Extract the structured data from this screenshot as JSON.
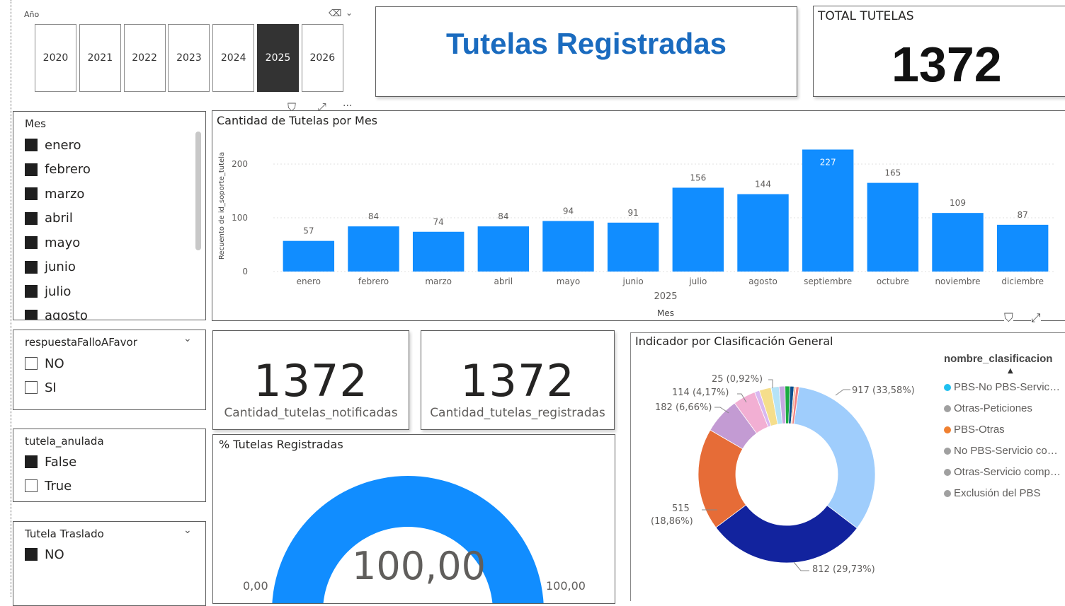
{
  "year_slicer": {
    "title": "Año",
    "years": [
      "2020",
      "2021",
      "2022",
      "2023",
      "2024",
      "2025",
      "2026"
    ],
    "selected": "2025"
  },
  "header": {
    "title": "Tutelas Registradas",
    "title_color": "#1a6bbf"
  },
  "total_card": {
    "label": "TOTAL TUTELAS",
    "value": "1372"
  },
  "mes_slicer": {
    "title": "Mes",
    "items": [
      {
        "label": "enero",
        "checked": true
      },
      {
        "label": "febrero",
        "checked": true
      },
      {
        "label": "marzo",
        "checked": true
      },
      {
        "label": "abril",
        "checked": true
      },
      {
        "label": "mayo",
        "checked": true
      },
      {
        "label": "junio",
        "checked": true
      },
      {
        "label": "julio",
        "checked": true
      },
      {
        "label": "agosto",
        "checked": true
      }
    ]
  },
  "bar_chart": {
    "title": "Cantidad de Tutelas por Mes",
    "bar_color": "#118dff"
  },
  "respuesta_slicer": {
    "title": "respuestaFalloAFavor",
    "items": [
      {
        "label": "NO",
        "checked": false
      },
      {
        "label": "SI",
        "checked": false
      }
    ]
  },
  "anulada_slicer": {
    "title": "tutela_anulada",
    "items": [
      {
        "label": "False",
        "checked": true
      },
      {
        "label": "True",
        "checked": false
      }
    ]
  },
  "traslado_slicer": {
    "title": "Tutela Traslado",
    "items": [
      {
        "label": "NO",
        "checked": true
      }
    ]
  },
  "kpi_notificadas": {
    "value": "1372",
    "label": "Cantidad_tutelas_notificadas"
  },
  "kpi_registradas": {
    "value": "1372",
    "label": "Cantidad_tutelas_registradas"
  },
  "gauge": {
    "title": "% Tutelas Registradas",
    "value_label": "100,00",
    "min_label": "0,00",
    "max_label": "100,00",
    "fill_fraction": 1.0,
    "color": "#118dff"
  },
  "donut": {
    "title": "Indicador por Clasificación General",
    "legend_title": "nombre_clasificacion",
    "legend": [
      {
        "label": "PBS-No PBS-Servic…",
        "color": "#20c0f0"
      },
      {
        "label": "Otras-Peticiones",
        "color": "#a0a0a0"
      },
      {
        "label": "PBS-Otras",
        "color": "#f08030"
      },
      {
        "label": "No PBS-Servicio co…",
        "color": "#a0a0a0"
      },
      {
        "label": "Otras-Servicio comp…",
        "color": "#a0a0a0"
      },
      {
        "label": "Exclusión del PBS",
        "color": "#a0a0a0"
      }
    ],
    "labels": {
      "l917": "917 (33,58%)",
      "l812": "812 (29,73%)",
      "l515a": "515",
      "l515b": "(18,86%)",
      "l182": "182 (6,66%)",
      "l114": "114 (4,17%)",
      "l25": "25 (0,92%)"
    }
  },
  "chart_data": {
    "type": "bar",
    "title": "Cantidad de Tutelas por Mes",
    "xlabel": "Mes",
    "x_group_label": "2025",
    "ylabel": "Recuento de id_soporte_tutela",
    "categories": [
      "enero",
      "febrero",
      "marzo",
      "abril",
      "mayo",
      "junio",
      "julio",
      "agosto",
      "septiembre",
      "octubre",
      "noviembre",
      "diciembre"
    ],
    "values": [
      57,
      84,
      74,
      84,
      94,
      91,
      156,
      144,
      227,
      165,
      109,
      87
    ],
    "ylim": [
      0,
      240
    ],
    "yticks": [
      0,
      100,
      200
    ],
    "grid": true,
    "donut": {
      "type": "pie",
      "values": [
        917,
        812,
        515,
        182,
        114,
        25,
        60,
        40,
        30,
        25,
        20,
        10,
        15
      ],
      "colors": [
        "#9fcdfc",
        "#12239e",
        "#e66c37",
        "#c39bd3",
        "#f2afd3",
        "#d9b8f0",
        "#f5de8c",
        "#b5e3f7",
        "#c5a8e0",
        "#1aab40",
        "#0b4f8c",
        "#f5b69a",
        "#f08080"
      ]
    }
  }
}
